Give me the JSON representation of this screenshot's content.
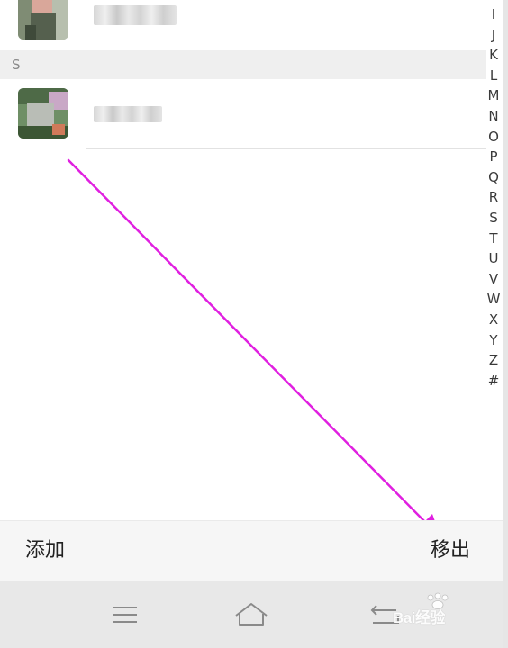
{
  "section": {
    "letter": "S"
  },
  "alphabet_index": [
    "I",
    "J",
    "K",
    "L",
    "M",
    "N",
    "O",
    "P",
    "Q",
    "R",
    "S",
    "T",
    "U",
    "V",
    "W",
    "X",
    "Y",
    "Z",
    "#"
  ],
  "action_bar": {
    "add_label": "添加",
    "remove_label": "移出"
  },
  "watermark": {
    "text": "Bai经验"
  },
  "colors": {
    "arrow": "#e020e0",
    "action_bar_bg": "#f6f6f6",
    "nav_bar_bg": "#e8e8e8",
    "section_header_bg": "#efefef"
  },
  "icons": {
    "nav_menu": "menu-icon",
    "nav_home": "home-icon",
    "nav_back": "back-icon"
  }
}
